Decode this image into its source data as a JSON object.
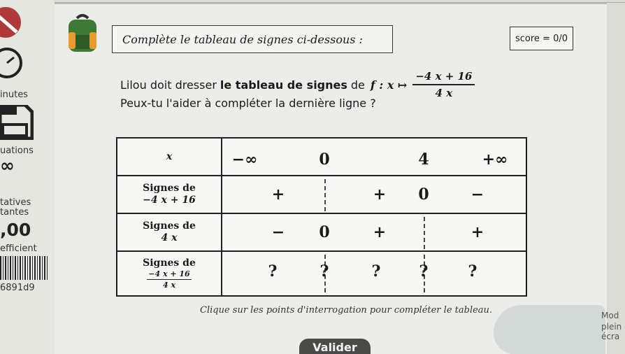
{
  "sidebar": {
    "items": [
      {
        "label": "inutes"
      },
      {
        "label": "uations"
      },
      {
        "label": "tatives"
      },
      {
        "label": "tantes"
      },
      {
        "label": ",00"
      },
      {
        "label": "efficient"
      },
      {
        "label": "6891d9"
      }
    ],
    "icons": [
      "forbidden-icon",
      "timer-icon",
      "save-icon",
      "infinity-icon",
      "barcode-icon"
    ]
  },
  "exercise": {
    "title": "Complète le tableau de signes ci-dessous :",
    "score": "score = 0/0",
    "statement_text": "Lilou doit dresser",
    "statement_bold": "le tableau de signes",
    "statement_de": "de",
    "function_name": "f : x ↦",
    "numerator": "−4 x + 16",
    "denominator": "4 x",
    "question": "Peux-tu l'aider à compléter la dernière ligne ?"
  },
  "table": {
    "header": {
      "label": "x",
      "values": [
        "−∞",
        "0",
        "4",
        "+∞"
      ]
    },
    "row1": {
      "label_line1": "Signes de",
      "label_line2": "−4 x + 16",
      "values": [
        "+",
        "+",
        "0",
        "−"
      ]
    },
    "row2": {
      "label_line1": "Signes de",
      "label_line2": "4 x",
      "values": [
        "−",
        "0",
        "+",
        "+"
      ]
    },
    "row3": {
      "label_line1": "Signes de",
      "label_num": "−4 x + 16",
      "label_den": "4 x",
      "values": [
        "?",
        "?",
        "?",
        "?",
        "?"
      ]
    }
  },
  "hint": "Clique sur les points d'interrogation pour compléter le tableau.",
  "validate_label": "Valider",
  "right_panel": {
    "lines": [
      "Mod",
      "plein",
      "écra"
    ]
  }
}
